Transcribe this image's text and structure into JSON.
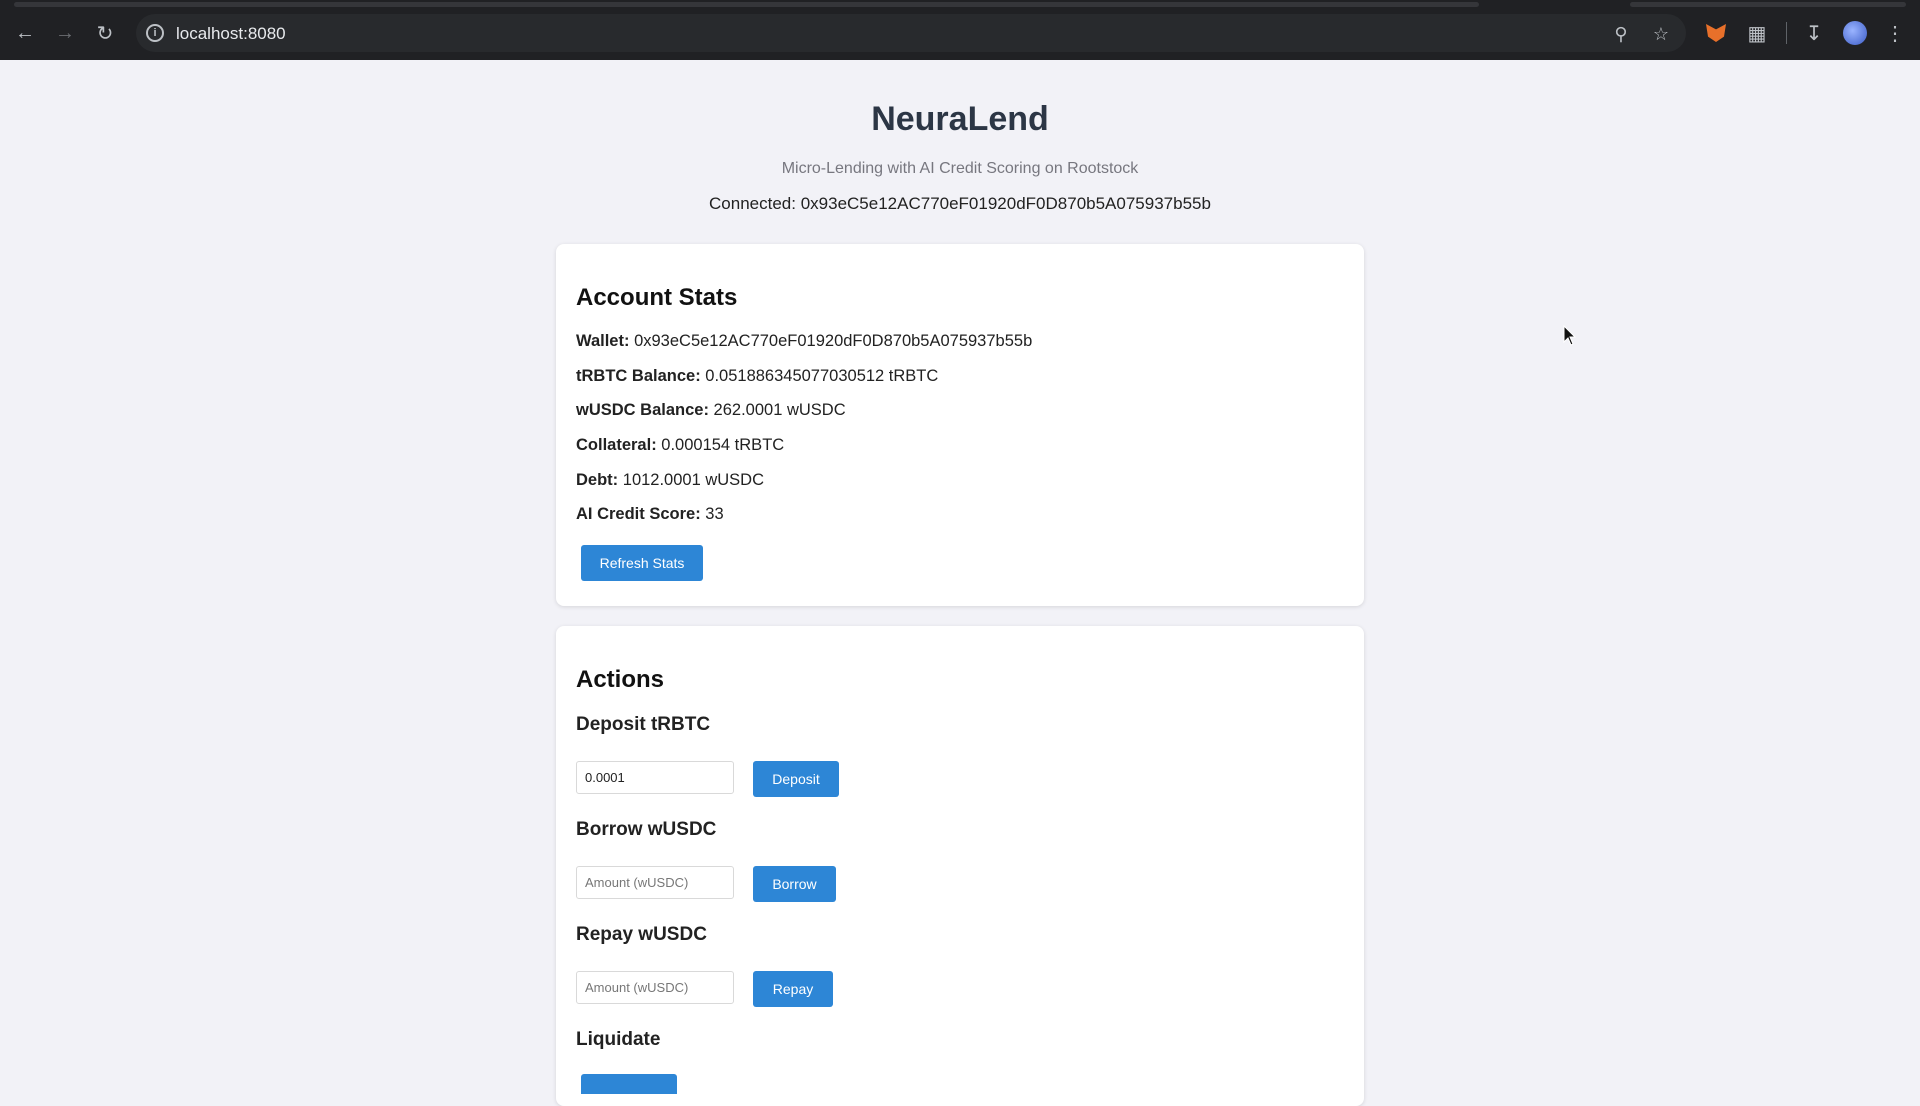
{
  "browser": {
    "url": "localhost:8080",
    "icons": [
      "back-icon",
      "forward-icon",
      "reload-icon",
      "site-info-icon",
      "zoom-icon",
      "bookmark-star-icon",
      "metamask-fox-icon",
      "extensions-icon",
      "download-icon",
      "profile-avatar-icon",
      "menu-icon"
    ]
  },
  "header": {
    "title": "NeuraLend",
    "subtitle": "Micro-Lending with AI Credit Scoring on Rootstock",
    "connected": "Connected: 0x93eC5e12AC770eF01920dF0D870b5A075937b55b"
  },
  "stats": {
    "heading": "Account Stats",
    "rows": [
      {
        "label": "Wallet:",
        "value": "0x93eC5e12AC770eF01920dF0D870b5A075937b55b"
      },
      {
        "label": "tRBTC Balance:",
        "value": "0.051886345077030512 tRBTC"
      },
      {
        "label": "wUSDC Balance:",
        "value": "262.0001 wUSDC"
      },
      {
        "label": "Collateral:",
        "value": "0.000154 tRBTC"
      },
      {
        "label": "Debt:",
        "value": "1012.0001 wUSDC"
      },
      {
        "label": "AI Credit Score:",
        "value": "33"
      }
    ],
    "refresh_label": "Refresh Stats"
  },
  "actions": {
    "heading": "Actions",
    "deposit": {
      "title": "Deposit tRBTC",
      "value": "0.0001",
      "button": "Deposit"
    },
    "borrow": {
      "title": "Borrow wUSDC",
      "placeholder": "Amount (wUSDC)",
      "button": "Borrow"
    },
    "repay": {
      "title": "Repay wUSDC",
      "placeholder": "Amount (wUSDC)",
      "button": "Repay"
    },
    "liquidate": {
      "title": "Liquidate"
    }
  },
  "colors": {
    "accent": "#2d86d6",
    "page_bg": "#f2f2f7",
    "browser_bg": "#202124"
  }
}
